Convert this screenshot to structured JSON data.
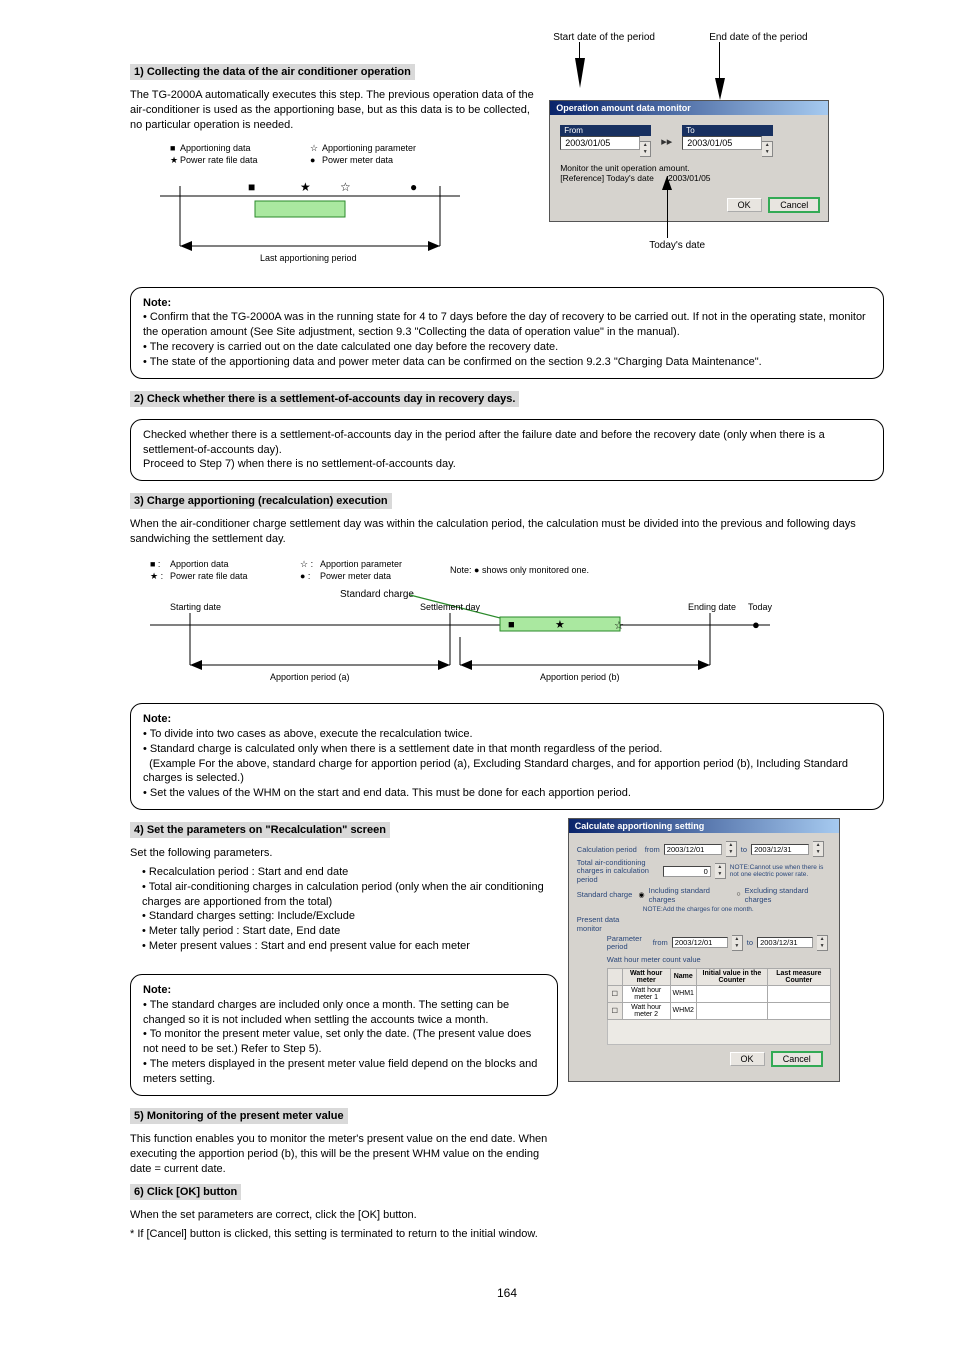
{
  "s1": {
    "hdr": "1) Collecting the data of the air conditioner operation",
    "p1": "The TG-2000A automatically executes this step. The previous operation data of the air-conditioner is used as the apportioning base, but as this data is to be collected, no particular operation is needed.",
    "tl": {
      "square_label": "Apportioning data",
      "filledstar_label": "Power rate file data",
      "openstar_label": "Apportioning parameter",
      "circle_label": "Power meter data",
      "period": "Last apportioning period"
    }
  },
  "dlg1": {
    "title": "Operation amount data monitor",
    "from_label": "From",
    "from_value": "2003/01/05",
    "to_label": "To",
    "to_value": "2003/01/05",
    "line1": "Monitor the unit operation amount.",
    "line2_a": "[Reference] Today's date",
    "line2_b": "2003/01/05",
    "ok": "OK",
    "cancel": "Cancel",
    "callout_start": "Start date of the period",
    "callout_end": "End date of the period",
    "callout_today": "Today's date"
  },
  "note1": {
    "bold": "Note:",
    "li1": "• Confirm that the TG-2000A was in the running state for 4 to 7 days before the day of recovery to be carried out. If not in the operating state, monitor the operation amount (See Site adjustment, section 9.3 \"Collecting the data of operation value\" in the manual).",
    "li2": "• The recovery is carried out on the date calculated one day before the recovery date.",
    "li3": "• The state of the apportioning data and power meter data can be confirmed on the section 9.2.3 \"Charging Data Maintenance\"."
  },
  "hdr2": "2) Check whether there is a settlement-of-accounts day in recovery days.",
  "note2": {
    "p": "Checked whether there is a settlement-of-accounts day in the period after the failure date and before the recovery date (only when there is a settlement-of-accounts day).",
    "li": "Proceed to Step 7) when there is no settlement-of-accounts day."
  },
  "hdr3": "3) Charge apportioning (recalculation) execution",
  "p3": "When the air-conditioner charge settlement day was within the calculation period, the calculation must be divided into the previous and following days sandwiching the settlement day.",
  "tl2": {
    "standard_label": "Standard charge",
    "legend_sq": "Apportion data",
    "legend_fs": "Power rate file data",
    "legend_os": "Apportion parameter",
    "legend_c": "Power meter data",
    "note": "Note: ● shows only monitored one.",
    "period_a": "Apportion period (a)",
    "period_b": "Apportion period (b)",
    "start": "Starting date",
    "settle": "Settlement day",
    "end": "Ending date",
    "today": "Today"
  },
  "note3": {
    "bold": "Note:",
    "li1": "• To divide into two cases as above, execute the recalculation twice.",
    "li2a": "• Standard charge is calculated only when there is a settlement date in that month regardless of the period.",
    "li2b": "(Example For the above, standard charge for apportion period (a), Excluding Standard charges, and for apportion period (b), Including Standard charges is selected.)",
    "li3": "• Set the values of the WHM on the start and end data. This must be done for each apportion period."
  },
  "hdr4": "4) Set the parameters on \"Recalculation\" screen",
  "p4": "Set the following parameters.",
  "params": {
    "l1": "• Recalculation period     : Start and end date",
    "l2": "• Total air-conditioning charges in calculation period (only when the air conditioning charges are apportioned from the total)",
    "l3": "• Standard charges setting: Include/Exclude",
    "l4": "• Meter tally period       : Start date, End date",
    "l5": "• Meter present values     : Start and end present value for each meter"
  },
  "note4": {
    "bold": "Note:",
    "li1": "• The standard charges are included only once a month. The setting can be changed so it is not included when settling the accounts twice a month.",
    "li2": "• To monitor the present meter value, set only the date. (The present value does not need to be set.) Refer to Step 5).",
    "li3": "• The meters displayed in the present meter value field depend on the blocks and meters setting."
  },
  "hdr5": "5) Monitoring of the present meter value",
  "p5": "This function enables you to monitor the meter's present value on the end date. When executing the apportion period (b), this will be the present WHM value on the ending date = current date.",
  "hdr6": "6) Click [OK] button",
  "p6a": "When the set parameters are correct, click the [OK] button.",
  "p6b": "*  If [Cancel] button is clicked, this setting is terminated to return to the initial window.",
  "dlg2": {
    "title": "Calculate apportioning setting",
    "calc_period": "Calculation period",
    "from": "from",
    "from_v": "2003/12/01",
    "to": "to",
    "to_v": "2003/12/31",
    "total_lbl": "Total air-conditioning charges in calculation period",
    "total_v": "0",
    "total_note": "NOTE:Cannot use when there is not one electric power rate.",
    "std_lbl": "Standard charge",
    "opt1": "Including standard charges",
    "opt2": "Excluding standard charges",
    "std_note": "NOTE:Add the charges for one month.",
    "present_lbl": "Present data monitor",
    "param_period": "Parameter period",
    "pp_from_v": "2003/12/01",
    "pp_to_v": "2003/12/31",
    "tbl_hdr": "Watt hour meter count value",
    "th1": "Watt hour meter",
    "th2": "Name",
    "th3": "Initial value in the Counter",
    "th4": "Last measure Counter",
    "r1a": "Watt hour meter 1",
    "r1b": "WHM1",
    "r2a": "Watt hour meter 2",
    "r2b": "WHM2",
    "ok": "OK",
    "cancel": "Cancel"
  },
  "pagenum": "164"
}
